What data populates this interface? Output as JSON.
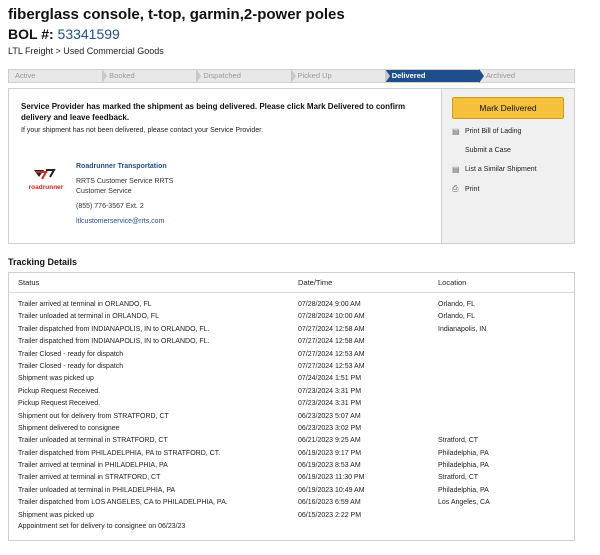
{
  "header": {
    "title": "fiberglass console, t-top, garmin,2-power poles",
    "bol_label": "BOL #:",
    "bol_number": "53341599",
    "breadcrumb": "LTL Freight > Used Commercial Goods"
  },
  "steps": [
    "Active",
    "Booked",
    "Dispatched",
    "Picked Up",
    "Delivered",
    "Archived"
  ],
  "active_step": "Delivered",
  "card": {
    "message": "Service Provider has marked the shipment as being delivered. Please click Mark Delivered to confirm delivery and leave feedback.",
    "sub_message": "If your shipment has not been delivered, please contact your Service Provider.",
    "provider": {
      "logo_text": "roadrunner",
      "name": "Roadrunner Transportation",
      "line1": "RRTS Customer Service RRTS",
      "line2": "Customer Service",
      "phone": "(855) 776-3567 Ext. 2",
      "email": "ltlcustomerservice@rrts.com"
    },
    "mark_delivered": "Mark Delivered",
    "actions": {
      "print_bol": "Print Bill of Lading",
      "submit_case": "Submit a Case",
      "list_similar": "List a Similar Shipment",
      "print": "Print"
    }
  },
  "tracking": {
    "heading": "Tracking Details",
    "columns": {
      "status": "Status",
      "datetime": "Date/Time",
      "location": "Location"
    },
    "rows": [
      {
        "status": "Trailer arrived at terminal in ORLANDO, FL",
        "datetime": "07/28/2024 9:00 AM",
        "location": "Orlando, FL"
      },
      {
        "status": "Trailer unloaded at terminal in ORLANDO, FL",
        "datetime": "07/28/2024 10:00 AM",
        "location": "Orlando, FL"
      },
      {
        "status": "Trailer dispatched from INDIANAPOLIS, IN to ORLANDO, FL.",
        "datetime": "07/27/2024 12:58 AM",
        "location": "Indianapolis, IN"
      },
      {
        "status": "Trailer dispatched from INDIANAPOLIS, IN to ORLANDO, FL.",
        "datetime": "07/27/2024 12:58 AM",
        "location": ""
      },
      {
        "status": "Trailer Closed - ready for dispatch",
        "datetime": "07/27/2024 12:53 AM",
        "location": ""
      },
      {
        "status": "Trailer Closed - ready for dispatch",
        "datetime": "07/27/2024 12:53 AM",
        "location": ""
      },
      {
        "status": "Shipment was picked up",
        "datetime": "07/24/2024 1:51 PM",
        "location": ""
      },
      {
        "status": "Pickup Request Received.",
        "datetime": "07/23/2024 3:31 PM",
        "location": ""
      },
      {
        "status": "Pickup Request Received.",
        "datetime": "07/23/2024 3:31 PM",
        "location": ""
      },
      {
        "status": "Shipment out for delivery from STRATFORD, CT",
        "datetime": "06/23/2023 5:07 AM",
        "location": ""
      },
      {
        "status": "Shipment delivered to consignee",
        "datetime": "06/23/2023 3:02 PM",
        "location": ""
      },
      {
        "status": "Trailer unloaded at terminal in STRATFORD, CT",
        "datetime": "06/21/2023 9:25 AM",
        "location": "Stratford, CT"
      },
      {
        "status": "Trailer dispatched from PHILADELPHIA, PA to STRATFORD, CT.",
        "datetime": "06/19/2023 9:17 PM",
        "location": "Philadelphia, PA"
      },
      {
        "status": "Trailer arrived at terminal in PHILADELPHIA, PA",
        "datetime": "06/19/2023 8:53 AM",
        "location": "Philadelphia, PA"
      },
      {
        "status": "Trailer arrived at terminal in STRATFORD, CT",
        "datetime": "06/19/2023 11:30 PM",
        "location": "Stratford, CT"
      },
      {
        "status": "Trailer unloaded at terminal in PHILADELPHIA, PA",
        "datetime": "06/19/2023 10:49 AM",
        "location": "Philadelphia, PA"
      },
      {
        "status": "Trailer dispatched from LOS ANGELES, CA to PHILADELPHIA, PA.",
        "datetime": "06/16/2023 6:59 AM",
        "location": "Los Angeles, CA"
      },
      {
        "status": "Shipment was picked up",
        "datetime": "06/15/2023 2:22 PM",
        "location": ""
      }
    ],
    "note": "Appointment set for delivery to consignee on 06/23/23"
  }
}
